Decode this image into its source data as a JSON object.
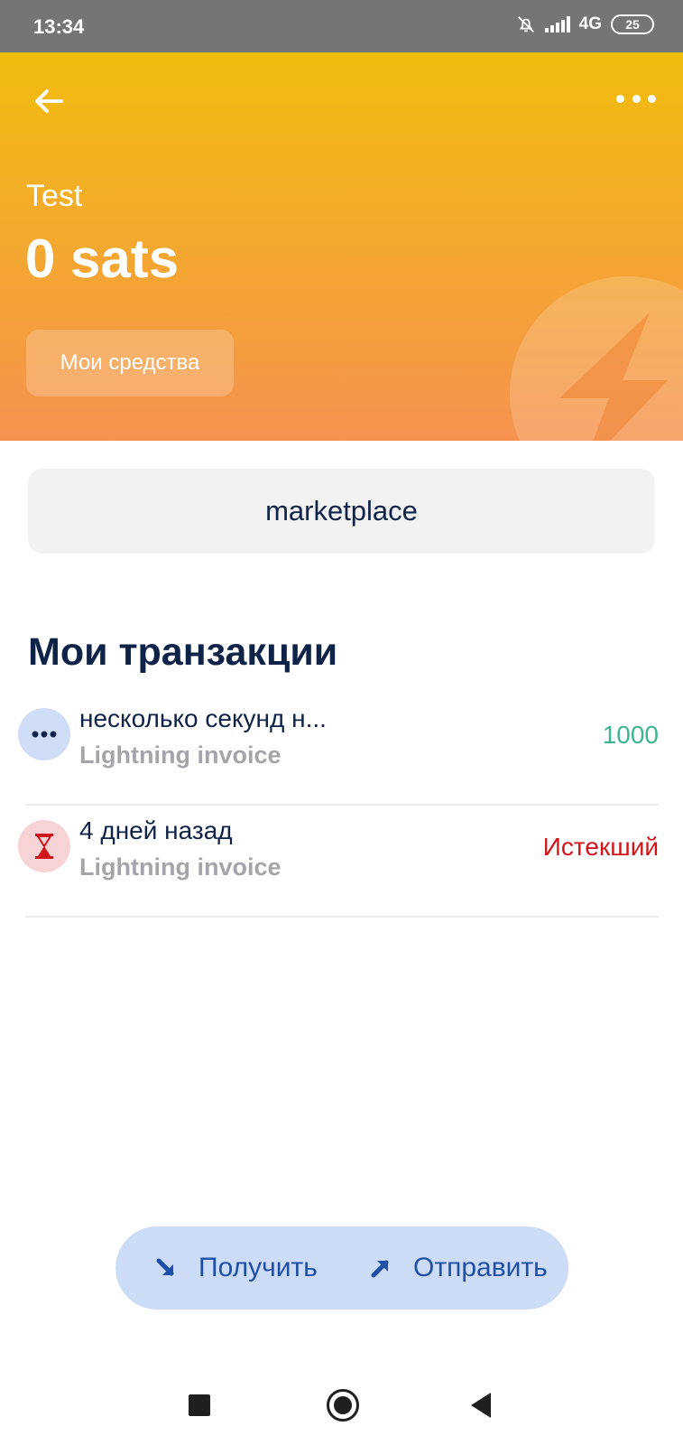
{
  "status_bar": {
    "time": "13:34",
    "network": "4G",
    "battery": "25",
    "icons": [
      "bell-off-icon",
      "signal-icon",
      "battery-icon"
    ]
  },
  "header": {
    "wallet_name": "Test",
    "balance": "0 sats",
    "funds_button": "Мои средства",
    "colors": {
      "gradient_top": "#f1bd0d",
      "gradient_bottom": "#f6924f"
    },
    "icons": [
      "back-arrow-icon",
      "more-options-icon",
      "lightning-bolt-icon"
    ]
  },
  "marketplace": {
    "label": "marketplace"
  },
  "transactions": {
    "title": "Мои транзакции",
    "items": [
      {
        "title": "несколько секунд н...",
        "subtitle": "Lightning invoice",
        "amount": "1000",
        "status_color": "#3fb58f",
        "icon": "pending-dots-icon"
      },
      {
        "title": "4 дней назад",
        "subtitle": "Lightning invoice",
        "amount": "Истекший",
        "status_color": "#d0161b",
        "icon": "hourglass-icon"
      }
    ]
  },
  "actions": {
    "receive_label": "Получить",
    "send_label": "Отправить",
    "color": "#1e4fa6"
  },
  "nav_bar": {
    "icons": [
      "recent-apps-icon",
      "home-icon",
      "back-icon"
    ]
  }
}
